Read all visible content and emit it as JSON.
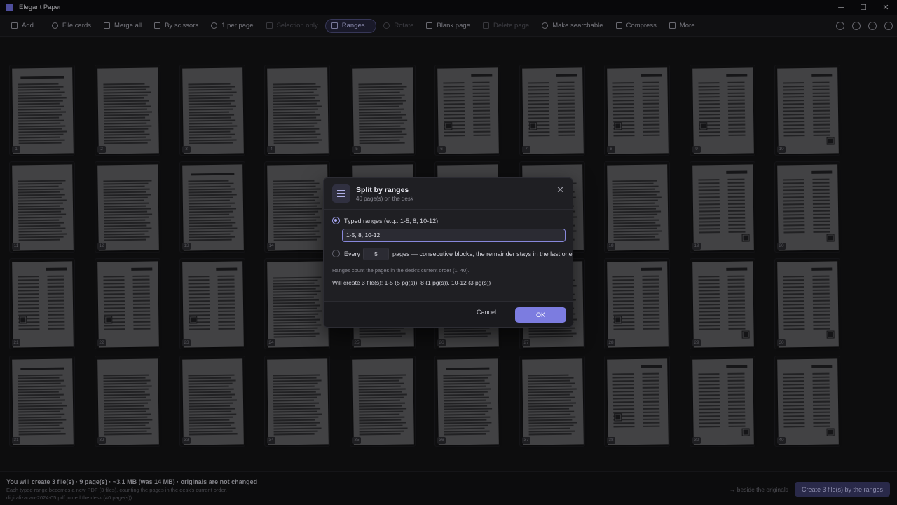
{
  "app": {
    "title": "Elegant Paper"
  },
  "window_controls": {
    "minimize": "─",
    "maximize": "☐",
    "close": "✕"
  },
  "toolbar": {
    "items": [
      {
        "label": "Add...",
        "icon": "add-file-icon",
        "state": "normal"
      },
      {
        "label": "File cards",
        "icon": "grid-icon",
        "state": "normal"
      },
      {
        "label": "Merge all",
        "icon": "merge-icon",
        "state": "normal"
      },
      {
        "label": "By scissors",
        "icon": "scissors-icon",
        "state": "normal"
      },
      {
        "label": "1 per page",
        "icon": "page-icon",
        "state": "normal"
      },
      {
        "label": "Selection only",
        "icon": "selection-icon",
        "state": "disabled"
      },
      {
        "label": "Ranges...",
        "icon": "ranges-icon",
        "state": "active"
      },
      {
        "label": "Rotate",
        "icon": "rotate-icon",
        "state": "disabled"
      },
      {
        "label": "Blank page",
        "icon": "blank-page-icon",
        "state": "normal"
      },
      {
        "label": "Delete page",
        "icon": "trash-icon",
        "state": "disabled"
      },
      {
        "label": "Make searchable",
        "icon": "search-icon",
        "state": "normal"
      },
      {
        "label": "Compress",
        "icon": "compress-icon",
        "state": "normal"
      },
      {
        "label": "More",
        "icon": "more-icon",
        "state": "normal"
      }
    ],
    "right_icons": [
      "history-icon",
      "settings-icon",
      "help-icon",
      "info-icon"
    ]
  },
  "desk": {
    "pages": [
      "1",
      "2",
      "3",
      "4",
      "5",
      "6",
      "7",
      "8",
      "9",
      "10",
      "11",
      "12",
      "13",
      "14",
      "15",
      "16",
      "17",
      "18",
      "19",
      "20",
      "21",
      "22",
      "23",
      "24",
      "25",
      "26",
      "27",
      "28",
      "29",
      "30",
      "31",
      "32",
      "33",
      "34",
      "35",
      "36",
      "37",
      "38",
      "39",
      "40"
    ]
  },
  "dialog": {
    "title": "Split by ranges",
    "subtitle": "40 page(s) on the desk",
    "close": "✕",
    "option_typed_label": "Typed ranges (e.g.: 1-5, 8, 10-12)",
    "ranges_value": "1-5, 8, 10-12",
    "option_every_label": "Every",
    "every_value": "5",
    "option_every_suffix": "pages — consecutive blocks, the remainder stays in the last one",
    "hint": "Ranges count the pages in the desk's current order (1–40).",
    "will_create": "Will create 3 file(s): 1-5 (5 pg(s)), 8 (1 pg(s)), 10-12 (3 pg(s))",
    "cancel": "Cancel",
    "ok": "OK",
    "selected_option": "typed"
  },
  "footer": {
    "summary": "You will create 3 file(s) · 9 page(s) · ~3.1 MB (was 14 MB) · originals are not changed",
    "detail": "Each typed range becomes a new PDF (3 files), counting the pages in the desk's current order.",
    "log": "digitalizacao-2024-05.pdf joined the desk (40 page(s)).",
    "destination": "→ beside the originals",
    "create_button": "Create 3 file(s) by the ranges"
  },
  "colors": {
    "accent": "#7c7ce0",
    "accent_dim": "#3a3a66",
    "background": "#141416"
  }
}
